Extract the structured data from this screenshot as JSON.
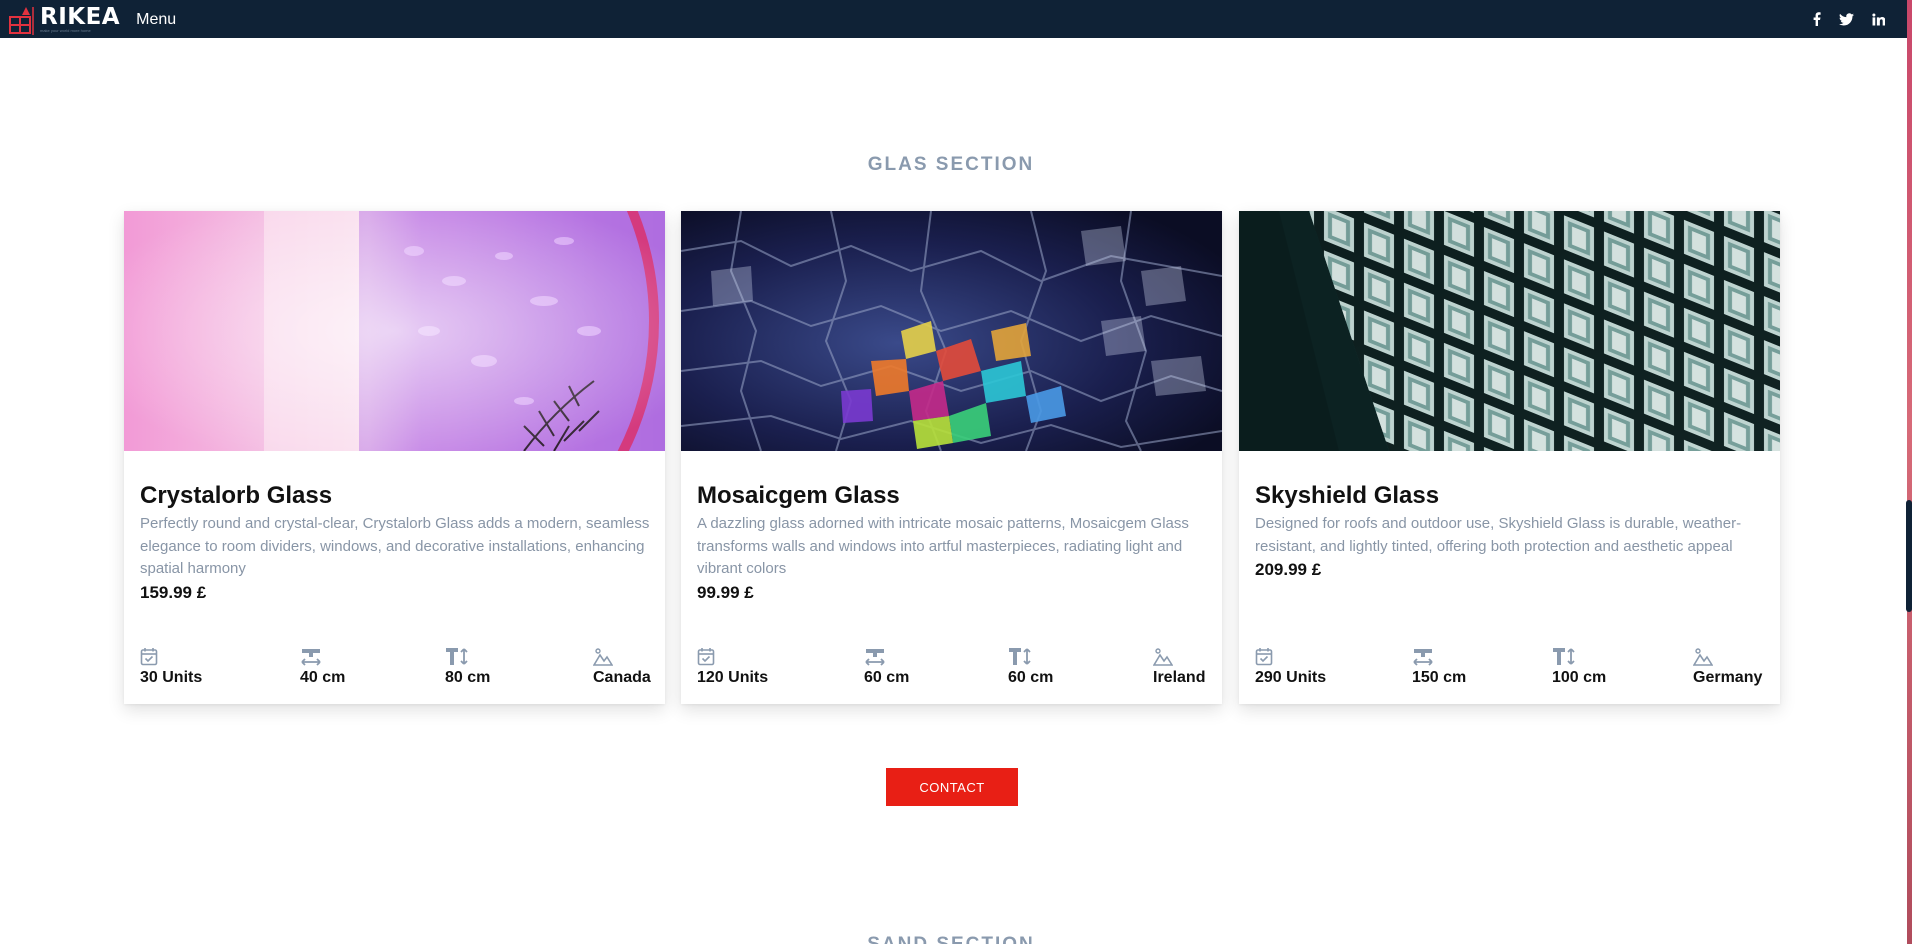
{
  "navbar": {
    "brand": "RIKEA",
    "tagline": "make your world more home",
    "menu_label": "Menu",
    "socials": [
      {
        "name": "facebook",
        "label": "f"
      },
      {
        "name": "twitter",
        "label": "twitter"
      },
      {
        "name": "linkedin",
        "label": "in"
      }
    ]
  },
  "glas_section": {
    "title": "GLAS SECTION",
    "cards": [
      {
        "title": "Crystalorb Glass",
        "description": "Perfectly round and crystal-clear, Crystalorb Glass adds a modern, seamless elegance to room dividers, windows, and decorative installations, enhancing spatial harmony",
        "price": "159.99 £",
        "specs": {
          "units": "30 Units",
          "width": "40 cm",
          "height": "80 cm",
          "origin": "Canada"
        }
      },
      {
        "title": "Mosaicgem Glass",
        "description": "A dazzling glass adorned with intricate mosaic patterns, Mosaicgem Glass transforms walls and windows into artful masterpieces, radiating light and vibrant colors",
        "price": "99.99 £",
        "specs": {
          "units": "120 Units",
          "width": "60 cm",
          "height": "60 cm",
          "origin": "Ireland"
        }
      },
      {
        "title": "Skyshield Glass",
        "description": "Designed for roofs and outdoor use, Skyshield Glass is durable, weather-resistant, and lightly tinted, offering both protection and aesthetic appeal",
        "price": "209.99 £",
        "specs": {
          "units": "290 Units",
          "width": "150 cm",
          "height": "100 cm",
          "origin": "Germany"
        }
      }
    ],
    "contact_label": "CONTACT"
  },
  "sand_section": {
    "title": "SAND SECTION"
  },
  "colors": {
    "navbar_bg": "#0f2236",
    "accent_red": "#e81f15",
    "section_title": "#8a9aae",
    "muted_text": "#8895a6"
  },
  "icons": {
    "units": "calendar-check-icon",
    "width": "width-arrows-icon",
    "height": "text-height-icon",
    "origin": "landscape-icon"
  }
}
